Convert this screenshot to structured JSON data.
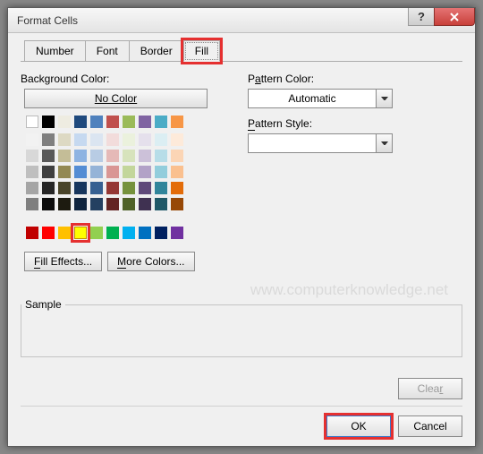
{
  "title": "Format Cells",
  "tabs": {
    "number": "Number",
    "font": "Font",
    "border": "Border",
    "fill": "Fill"
  },
  "labels": {
    "background_color": "Background Color:",
    "pattern_color": "Pattern Color:",
    "pattern_style": "Pattern Style:",
    "sample": "Sample"
  },
  "buttons": {
    "no_color": "No Color",
    "fill_effects": "Fill Effects...",
    "more_colors": "More Colors...",
    "clear": "Clear",
    "ok": "OK",
    "cancel": "Cancel"
  },
  "pattern_color_value": "Automatic",
  "palette_top": [
    [
      "#ffffff",
      "#000000",
      "#eeece1",
      "#1f497d",
      "#4f81bd",
      "#c0504d",
      "#9bbb59",
      "#8064a2",
      "#4bacc6",
      "#f79646"
    ]
  ],
  "palette_theme": [
    [
      "#f2f2f2",
      "#7f7f7f",
      "#ddd9c3",
      "#c6d9f0",
      "#dbe5f1",
      "#f2dcdb",
      "#ebf1dd",
      "#e5e0ec",
      "#dbeef3",
      "#fdeada"
    ],
    [
      "#d8d8d8",
      "#595959",
      "#c4bd97",
      "#8db3e2",
      "#b8cce4",
      "#e5b9b7",
      "#d7e3bc",
      "#ccc1d9",
      "#b7dde8",
      "#fbd5b5"
    ],
    [
      "#bfbfbf",
      "#3f3f3f",
      "#938953",
      "#548dd4",
      "#95b3d7",
      "#d99694",
      "#c3d69b",
      "#b2a2c7",
      "#92cddc",
      "#fac08f"
    ],
    [
      "#a5a5a5",
      "#262626",
      "#494429",
      "#17365d",
      "#366092",
      "#953734",
      "#76923c",
      "#5f497a",
      "#31859b",
      "#e36c09"
    ],
    [
      "#7f7f7f",
      "#0c0c0c",
      "#1d1b10",
      "#0f243e",
      "#244061",
      "#632423",
      "#4f6128",
      "#3f3151",
      "#205867",
      "#974806"
    ]
  ],
  "palette_standard": [
    [
      "#c00000",
      "#ff0000",
      "#ffc000",
      "#ffff00",
      "#92d050",
      "#00b050",
      "#00b0f0",
      "#0070c0",
      "#002060",
      "#7030a0"
    ]
  ],
  "selected_standard_index": 3,
  "watermark": "www.computerknowledge.net"
}
